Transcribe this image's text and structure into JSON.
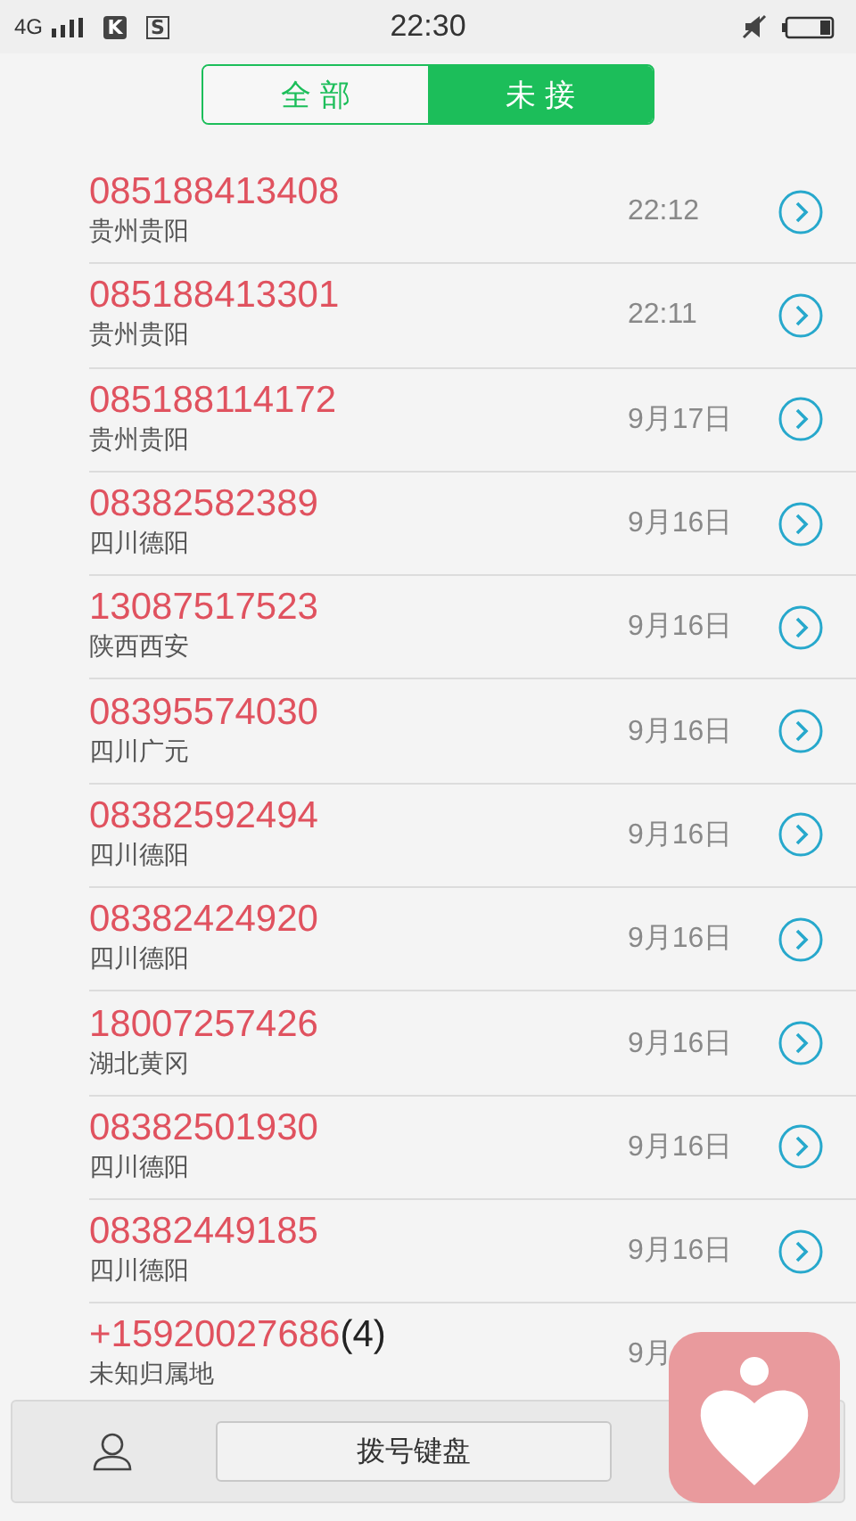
{
  "status_bar": {
    "network": "4G",
    "app_icons": [
      "K",
      "S"
    ],
    "time": "22:30"
  },
  "tabs": [
    {
      "label": "全 部",
      "selected": false
    },
    {
      "label": "未 接",
      "selected": true
    }
  ],
  "calls": [
    {
      "number": "085188413408",
      "location": "贵州贵阳",
      "time": "22:12",
      "arrow": true
    },
    {
      "number": "085188413301",
      "location": "贵州贵阳",
      "time": "22:11",
      "arrow": true
    },
    {
      "number": "085188114172",
      "location": "贵州贵阳",
      "time": "9月17日",
      "arrow": true
    },
    {
      "number": "08382582389",
      "location": "四川德阳",
      "time": "9月16日",
      "arrow": true
    },
    {
      "number": "13087517523",
      "location": "陕西西安",
      "time": "9月16日",
      "arrow": true
    },
    {
      "number": "08395574030",
      "location": "四川广元",
      "time": "9月16日",
      "arrow": true
    },
    {
      "number": "08382592494",
      "location": "四川德阳",
      "time": "9月16日",
      "arrow": true
    },
    {
      "number": "08382424920",
      "location": "四川德阳",
      "time": "9月16日",
      "arrow": true
    },
    {
      "number": "18007257426",
      "location": "湖北黄冈",
      "time": "9月16日",
      "arrow": true
    },
    {
      "number": "08382501930",
      "location": "四川德阳",
      "time": "9月16日",
      "arrow": true
    },
    {
      "number": "08382449185",
      "location": "四川德阳",
      "time": "9月16日",
      "arrow": true
    },
    {
      "number": "+15920027686",
      "count": "(4)",
      "location": "未知归属地",
      "time": "9月",
      "arrow": false
    }
  ],
  "bottom_bar": {
    "dialpad_button": "拨号键盘"
  }
}
